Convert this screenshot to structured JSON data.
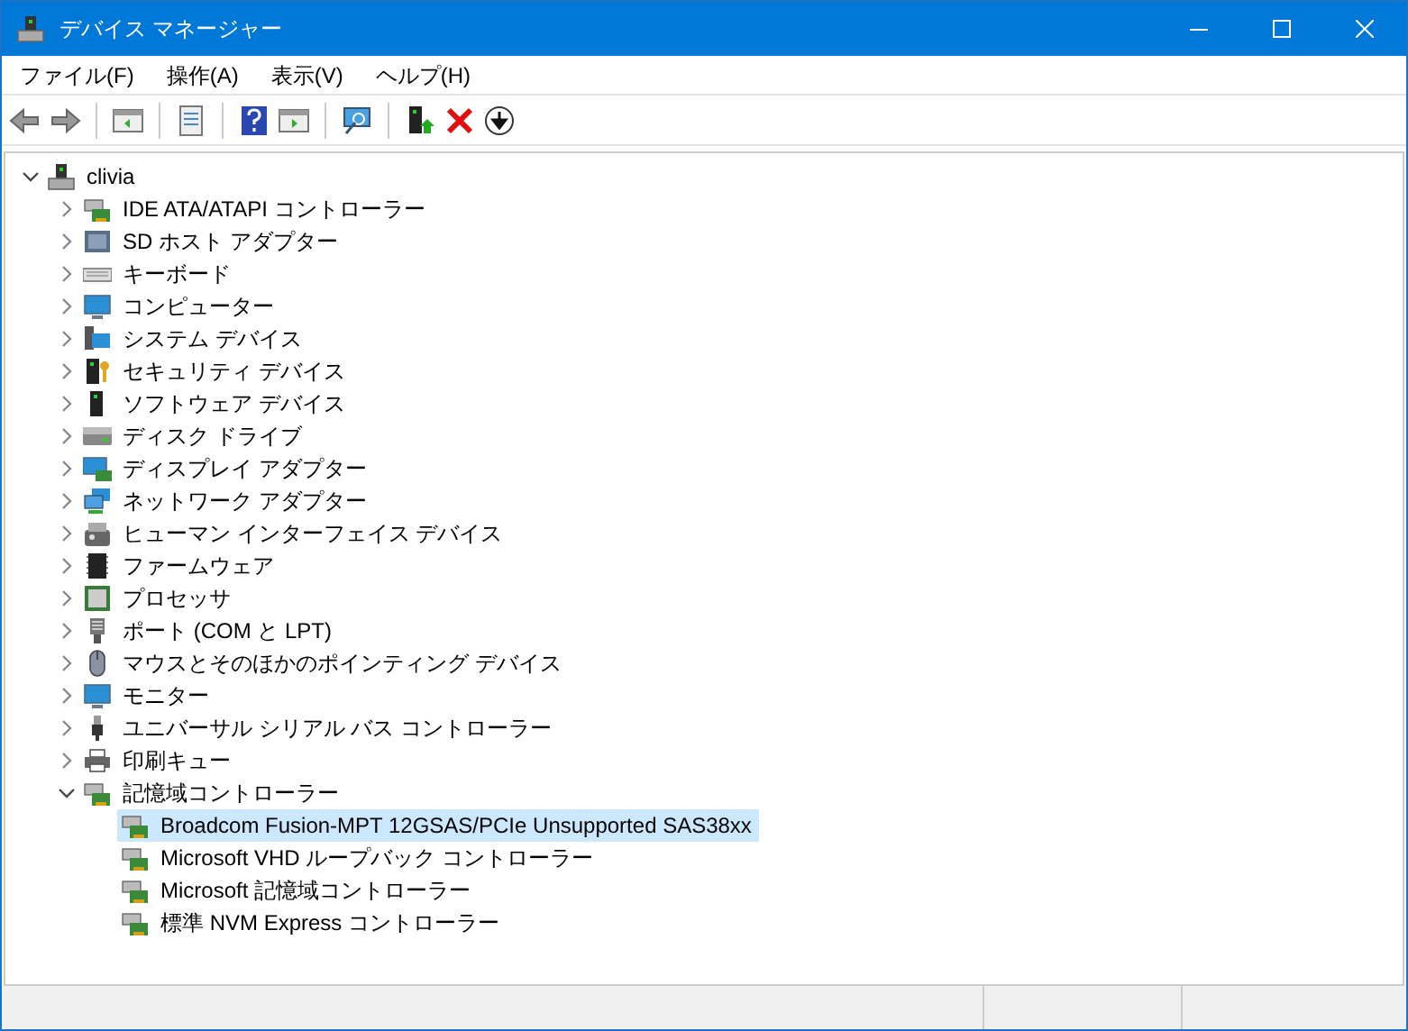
{
  "window": {
    "title": "デバイス マネージャー"
  },
  "menu": [
    "ファイル(F)",
    "操作(A)",
    "表示(V)",
    "ヘルプ(H)"
  ],
  "tree": {
    "label": "clivia",
    "expanded": true,
    "children": [
      {
        "label": "IDE ATA/ATAPI コントローラー",
        "expanded": false
      },
      {
        "label": "SD ホスト アダプター",
        "expanded": false
      },
      {
        "label": "キーボード",
        "expanded": false
      },
      {
        "label": "コンピューター",
        "expanded": false
      },
      {
        "label": "システム デバイス",
        "expanded": false
      },
      {
        "label": "セキュリティ デバイス",
        "expanded": false
      },
      {
        "label": "ソフトウェア デバイス",
        "expanded": false
      },
      {
        "label": "ディスク ドライブ",
        "expanded": false
      },
      {
        "label": "ディスプレイ アダプター",
        "expanded": false
      },
      {
        "label": "ネットワーク アダプター",
        "expanded": false
      },
      {
        "label": "ヒューマン インターフェイス デバイス",
        "expanded": false
      },
      {
        "label": "ファームウェア",
        "expanded": false
      },
      {
        "label": "プロセッサ",
        "expanded": false
      },
      {
        "label": "ポート (COM と LPT)",
        "expanded": false
      },
      {
        "label": "マウスとそのほかのポインティング デバイス",
        "expanded": false
      },
      {
        "label": "モニター",
        "expanded": false
      },
      {
        "label": "ユニバーサル シリアル バス コントローラー",
        "expanded": false
      },
      {
        "label": "印刷キュー",
        "expanded": false
      },
      {
        "label": "記憶域コントローラー",
        "expanded": true,
        "children": [
          {
            "label": "Broadcom Fusion-MPT 12GSAS/PCIe Unsupported SAS38xx",
            "selected": true
          },
          {
            "label": "Microsoft VHD ループバック コントローラー",
            "selected": false
          },
          {
            "label": "Microsoft 記憶域コントローラー",
            "selected": false
          },
          {
            "label": "標準 NVM Express コントローラー",
            "selected": false
          }
        ]
      }
    ]
  }
}
